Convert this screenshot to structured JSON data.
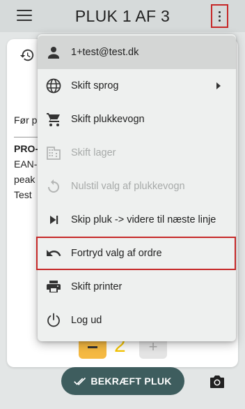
{
  "header": {
    "title": "PLUK 1 AF 3"
  },
  "background": {
    "line1": "Før p",
    "product_code": "PRO-",
    "ean": "EAN-",
    "peak": "peak",
    "test": "Test",
    "quantity": "2",
    "confirm_label": "BEKRÆFT PLUK"
  },
  "menu": {
    "user_email": "1+test@test.dk",
    "items": [
      {
        "label": "Skift sprog",
        "icon": "globe-icon",
        "disabled": false
      },
      {
        "label": "Skift plukkevogn",
        "icon": "cart-icon",
        "disabled": false
      },
      {
        "label": "Skift lager",
        "icon": "building-icon",
        "disabled": true
      },
      {
        "label": "Nulstil valg af plukkevogn",
        "icon": "reset-icon",
        "disabled": true
      },
      {
        "label": "Skip pluk -> videre til næste linje",
        "icon": "skip-next-icon",
        "disabled": false
      },
      {
        "label": "Fortryd valg af ordre",
        "icon": "undo-icon",
        "disabled": false
      },
      {
        "label": "Skift printer",
        "icon": "printer-icon",
        "disabled": false
      },
      {
        "label": "Log ud",
        "icon": "power-icon",
        "disabled": false
      }
    ]
  },
  "colors": {
    "highlight_border": "#c62828",
    "confirm_button": "#3e5d5e",
    "minus_button": "#f5b942",
    "quantity": "#f5c400"
  }
}
